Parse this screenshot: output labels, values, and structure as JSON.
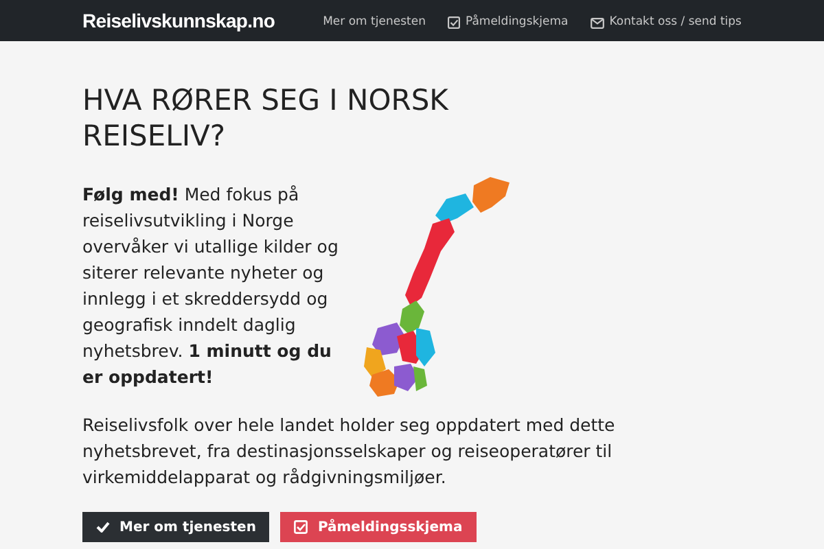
{
  "navbar": {
    "brand": "Reiselivskunnskap.no",
    "links": [
      {
        "label": "Mer om tjenesten",
        "kind": "plain"
      },
      {
        "label": "Påmeldingskjema",
        "kind": "check"
      },
      {
        "label": "Kontakt oss / send tips",
        "kind": "mail"
      }
    ]
  },
  "heading": "HVA RØRER SEG I NORSK REISELIV?",
  "intro": "**Følg med!** Med fokus på reiselivsutvikling i Norge overvåker vi utallige kilder og siterer relevante nyheter og innlegg i et skreddersydd og geografisk inndelt daglig nyhetsbrev. **1 minutt og du er oppdatert!**",
  "body": "Reiselivsfolk over hele landet holder seg oppdatert med dette nyhetsbrevet, fra destinasjonsselskaper og reiseoperatører til virkemiddelapparat og rådgivningsmiljøer.",
  "buttons": [
    {
      "label": "Mer om tjenesten",
      "kind": "dark"
    },
    {
      "label": "Påmeldingsskjema",
      "kind": "red"
    }
  ]
}
